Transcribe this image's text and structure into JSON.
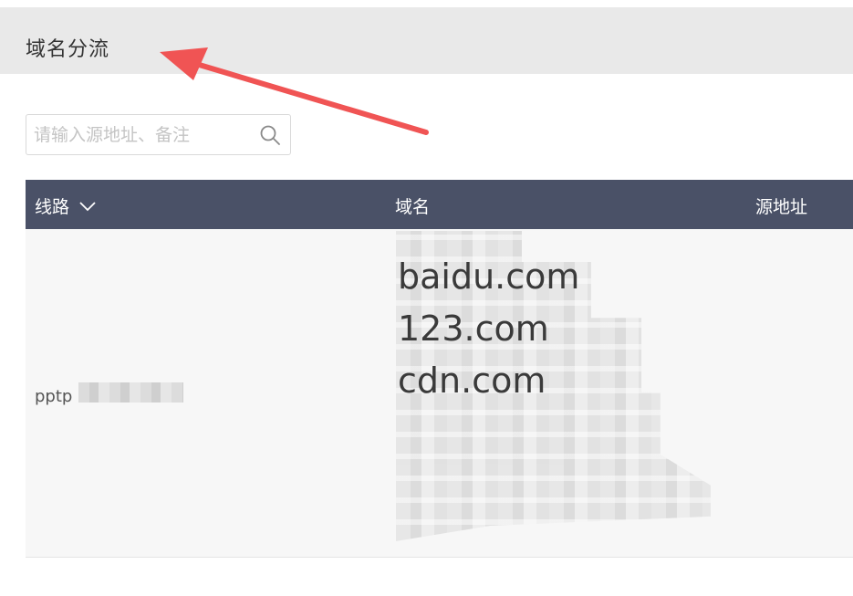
{
  "header": {
    "title": "域名分流"
  },
  "search": {
    "placeholder": "请输入源地址、备注",
    "value": ""
  },
  "table": {
    "columns": [
      "线路",
      "域名",
      "源地址"
    ],
    "rows": [
      {
        "line": "pptp",
        "domains": [
          "baidu.com",
          "123.com",
          "cdn.com"
        ],
        "source": ""
      }
    ]
  },
  "colors": {
    "header_bg": "#e9e9e9",
    "table_header_bg": "#4a5167",
    "row_bg": "#f7f7f7",
    "annotation_arrow": "#f05454"
  },
  "icons": [
    "search-icon",
    "chevron-down-icon",
    "annotation-arrow"
  ]
}
